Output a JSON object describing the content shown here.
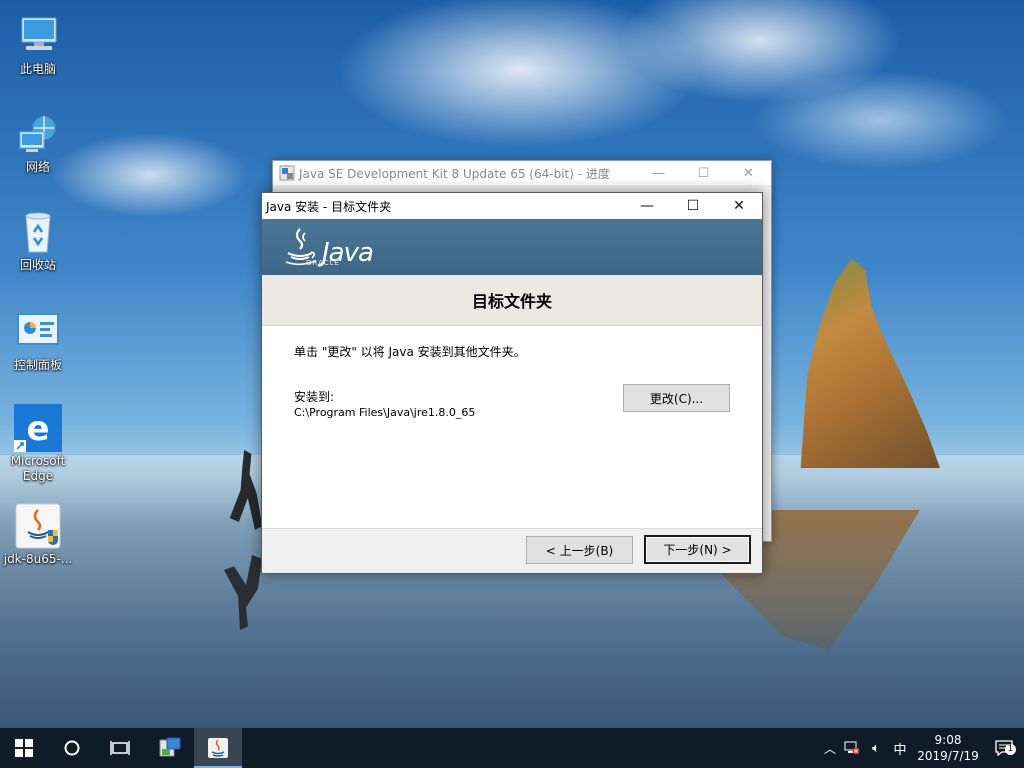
{
  "desktop": {
    "icons": [
      {
        "label": "此电脑",
        "icon": "computer-icon"
      },
      {
        "label": "网络",
        "icon": "network-icon"
      },
      {
        "label": "回收站",
        "icon": "recycle-bin-icon"
      },
      {
        "label": "控制面板",
        "icon": "control-panel-icon"
      },
      {
        "label": "Microsoft Edge",
        "icon": "edge-icon"
      },
      {
        "label": "jdk-8u65-...",
        "icon": "java-installer-icon"
      }
    ]
  },
  "background_window": {
    "title": "Java SE Development Kit 8 Update 65 (64-bit) - 进度"
  },
  "dialog": {
    "title": "Java 安装 - 目标文件夹",
    "brand": {
      "java": "Java",
      "oracle": "ORACLE"
    },
    "header": "目标文件夹",
    "description": "单击 \"更改\" 以将 Java 安装到其他文件夹。",
    "install_to_label": "安装到:",
    "install_path": "C:\\Program Files\\Java\\jre1.8.0_65",
    "change_button": "更改(C)...",
    "back_button": "< 上一步(B)",
    "next_button": "下一步(N) >"
  },
  "taskbar": {
    "clock_time": "9:08",
    "clock_date": "2019/7/19",
    "ime": "中",
    "notification_count": "1"
  },
  "colors": {
    "banner": "#446e8f",
    "taskbar": "#0f1c28",
    "header_strip": "#ebe9e1"
  }
}
